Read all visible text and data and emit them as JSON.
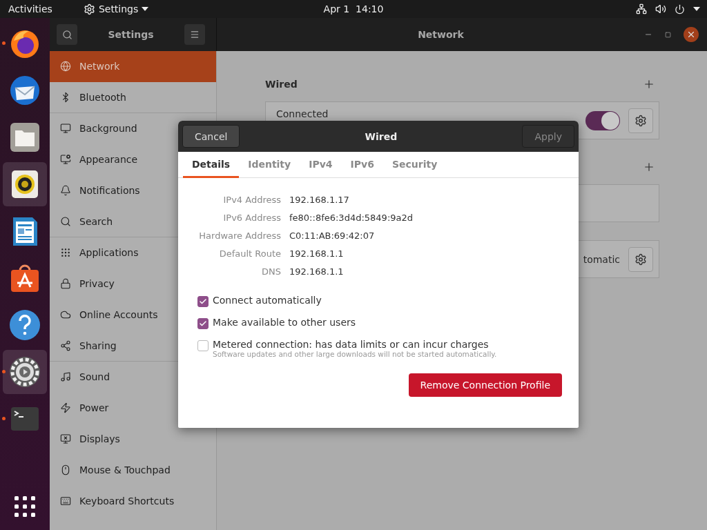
{
  "top_bar": {
    "activities": "Activities",
    "app_menu": "Settings",
    "clock": "Apr 1  14:10"
  },
  "dock": [
    {
      "running": true,
      "highlighted": false
    },
    {
      "running": false,
      "highlighted": false
    },
    {
      "running": false,
      "highlighted": false
    },
    {
      "running": false,
      "highlighted": true
    },
    {
      "running": false,
      "highlighted": false
    },
    {
      "running": false,
      "highlighted": false
    },
    {
      "running": false,
      "highlighted": false
    },
    {
      "running": true,
      "highlighted": true
    },
    {
      "running": true,
      "highlighted": false
    }
  ],
  "window": {
    "sidebar_title": "Settings",
    "title": "Network"
  },
  "sidebar": {
    "items": [
      {
        "label": "Network",
        "selected": true,
        "divider_after": false
      },
      {
        "label": "Bluetooth",
        "selected": false,
        "divider_after": true
      },
      {
        "label": "Background",
        "selected": false,
        "divider_after": false
      },
      {
        "label": "Appearance",
        "selected": false,
        "divider_after": false
      },
      {
        "label": "Notifications",
        "selected": false,
        "divider_after": false
      },
      {
        "label": "Search",
        "selected": false,
        "divider_after": true
      },
      {
        "label": "Applications",
        "selected": false,
        "divider_after": false
      },
      {
        "label": "Privacy",
        "selected": false,
        "divider_after": false
      },
      {
        "label": "Online Accounts",
        "selected": false,
        "divider_after": false
      },
      {
        "label": "Sharing",
        "selected": false,
        "divider_after": true
      },
      {
        "label": "Sound",
        "selected": false,
        "divider_after": false
      },
      {
        "label": "Power",
        "selected": false,
        "divider_after": false
      },
      {
        "label": "Displays",
        "selected": false,
        "divider_after": false
      },
      {
        "label": "Mouse & Touchpad",
        "selected": false,
        "divider_after": false
      },
      {
        "label": "Keyboard Shortcuts",
        "selected": false,
        "divider_after": false
      }
    ]
  },
  "content": {
    "sections": [
      {
        "heading": "Wired",
        "cards": [
          {
            "kind": "toggle",
            "label": "Connected",
            "on": true
          }
        ]
      },
      {
        "cards": [
          {
            "kind": "blank"
          },
          {
            "kind": "gear",
            "label": "tomatic"
          }
        ]
      }
    ]
  },
  "dialog": {
    "title": "Wired",
    "cancel": "Cancel",
    "apply": {
      "label": "Apply",
      "disabled": true
    },
    "tabs": [
      {
        "label": "Details",
        "selected": true
      },
      {
        "label": "Identity",
        "selected": false
      },
      {
        "label": "IPv4",
        "selected": false
      },
      {
        "label": "IPv6",
        "selected": false
      },
      {
        "label": "Security",
        "selected": false
      }
    ],
    "details": [
      {
        "label": "IPv4 Address",
        "value": "192.168.1.17"
      },
      {
        "label": "IPv6 Address",
        "value": "fe80::8fe6:3d4d:5849:9a2d"
      },
      {
        "label": "Hardware Address",
        "value": "C0:11:AB:69:42:07"
      },
      {
        "label": "Default Route",
        "value": "192.168.1.1"
      },
      {
        "label": "DNS",
        "value": "192.168.1.1"
      }
    ],
    "options": [
      {
        "label": "Connect automatically",
        "checked": true
      },
      {
        "label": "Make available to other users",
        "checked": true
      },
      {
        "label": "Metered connection: has data limits or can incur charges",
        "hint": "Software updates and other large downloads will not be started automatically.",
        "checked": false
      }
    ],
    "remove_button": "Remove Connection Profile"
  }
}
